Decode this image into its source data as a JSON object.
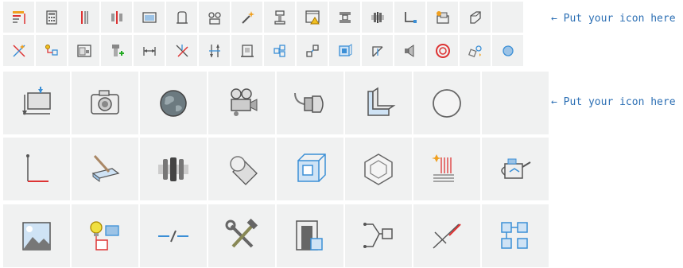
{
  "hints": {
    "small_set": "← Put your icon here",
    "large_set": "← Put your icon here"
  },
  "colors": {
    "tile_bg": "#f0f1f1",
    "hint_text": "#2c6fb4",
    "accent_red": "#d33",
    "accent_blue": "#3b8fd6",
    "accent_orange": "#f0a020"
  },
  "small_icons_row1": [
    "layer-tree-icon",
    "calculator-icon",
    "redline-bars-icon",
    "split-bars-icon",
    "folder-panel-icon",
    "extrude-profile-icon",
    "link-nodes-icon",
    "wand-sparkle-icon",
    "clamp-icon",
    "warning-window-icon",
    "hose-clip-icon",
    "coupling-icon",
    "corner-bend-icon",
    "stacked-boxes-icon",
    "prism-icon",
    "empty-slot"
  ],
  "small_icons_row2": [
    "scatter-select-icon",
    "nodes-connect-icon",
    "document-window-icon",
    "bolt-add-icon",
    "dimension-icon",
    "cross-lines-icon",
    "align-arrows-icon",
    "frame-bracket-icon",
    "grid-nodes-icon",
    "move-corner-icon",
    "cube-tile-icon",
    "angle-arrow-icon",
    "speaker-icon",
    "ring-target-icon",
    "rotate-shapes-icon",
    "sphere-icon"
  ],
  "large_icons_row1": [
    "insert-level-icon",
    "camera-icon",
    "globe-icon",
    "movie-camera-icon",
    "connector-plug-icon",
    "corner-block-icon",
    "circle-icon",
    "empty-slot"
  ],
  "large_icons_row2": [
    "dimension-corner-icon",
    "knife-block-icon",
    "coupling-joint-icon",
    "sphere-film-icon",
    "cube-view-icon",
    "hexagon-icon",
    "hatch-spark-icon",
    "watering-can-icon"
  ],
  "large_icons_row3": [
    "landscape-image-icon",
    "idea-flow-icon",
    "dash-slash-icon",
    "wrench-hammer-icon",
    "door-cube-icon",
    "cube-path-icon",
    "measure-cut-icon",
    "linked-cubes-icon"
  ]
}
